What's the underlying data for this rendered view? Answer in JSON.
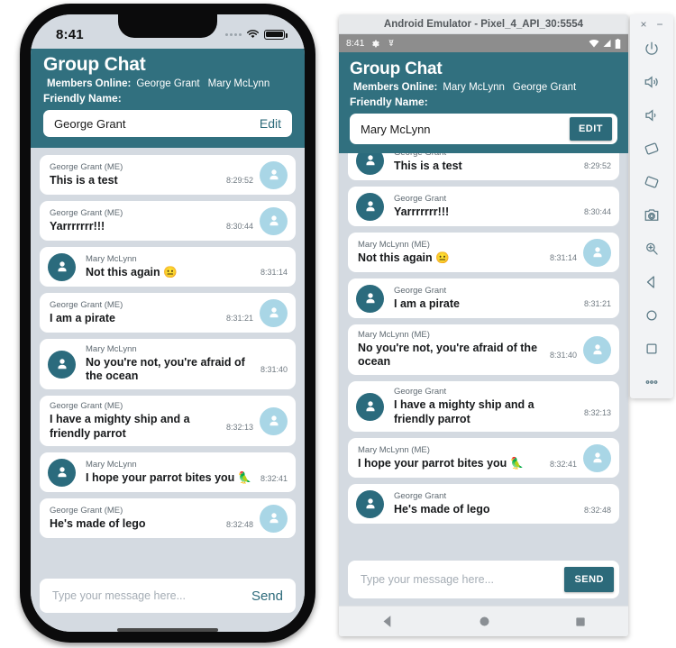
{
  "ios": {
    "status": {
      "time": "8:41",
      "signal_icon": "signal-dots-icon",
      "wifi_icon": "wifi-icon",
      "battery_icon": "battery-icon"
    },
    "header": {
      "title": "Group Chat",
      "members_label": "Members Online:",
      "members": [
        "George Grant",
        "Mary McLynn"
      ],
      "friendly_name_label": "Friendly Name:",
      "friendly_name_value": "George Grant",
      "edit_label": "Edit"
    },
    "messages": [
      {
        "sender": "George Grant (ME)",
        "text": "This is a test",
        "time": "8:29:52",
        "side": "mine"
      },
      {
        "sender": "George Grant (ME)",
        "text": "Yarrrrrrr!!!",
        "time": "8:30:44",
        "side": "mine"
      },
      {
        "sender": "Mary McLynn",
        "text": "Not this again 😐",
        "time": "8:31:14",
        "side": "theirs"
      },
      {
        "sender": "George Grant (ME)",
        "text": "I am a pirate",
        "time": "8:31:21",
        "side": "mine"
      },
      {
        "sender": "Mary McLynn",
        "text": "No you're not, you're afraid of the ocean",
        "time": "8:31:40",
        "side": "theirs"
      },
      {
        "sender": "George Grant (ME)",
        "text": "I have a mighty ship and a friendly parrot",
        "time": "8:32:13",
        "side": "mine"
      },
      {
        "sender": "Mary McLynn",
        "text": "I hope your parrot bites you 🦜",
        "time": "8:32:41",
        "side": "theirs"
      },
      {
        "sender": "George Grant (ME)",
        "text": "He's made of lego",
        "time": "8:32:48",
        "side": "mine"
      }
    ],
    "composer": {
      "placeholder": "Type your message here...",
      "send_label": "Send"
    }
  },
  "android": {
    "window_title": "Android Emulator - Pixel_4_API_30:5554",
    "status": {
      "time": "8:41",
      "gear_icon": "gear-icon",
      "debug_icon": "adb-icon",
      "wifi_icon": "wifi-icon",
      "signal_icon": "signal-icon",
      "battery_icon": "battery-icon"
    },
    "header": {
      "title": "Group Chat",
      "members_label": "Members Online:",
      "members": [
        "Mary McLynn",
        "George Grant"
      ],
      "friendly_name_label": "Friendly Name:",
      "friendly_name_value": "Mary McLynn",
      "edit_label": "EDIT"
    },
    "messages": [
      {
        "sender": "George Grant",
        "text": "This is a test",
        "time": "8:29:52",
        "side": "theirs"
      },
      {
        "sender": "George Grant",
        "text": "Yarrrrrrr!!!",
        "time": "8:30:44",
        "side": "theirs"
      },
      {
        "sender": "Mary McLynn (ME)",
        "text": "Not this again 😐",
        "time": "8:31:14",
        "side": "mine"
      },
      {
        "sender": "George Grant",
        "text": "I am a pirate",
        "time": "8:31:21",
        "side": "theirs"
      },
      {
        "sender": "Mary McLynn (ME)",
        "text": "No you're not, you're afraid of the ocean",
        "time": "8:31:40",
        "side": "mine"
      },
      {
        "sender": "George Grant",
        "text": "I have a mighty ship and a friendly parrot",
        "time": "8:32:13",
        "side": "theirs"
      },
      {
        "sender": "Mary McLynn (ME)",
        "text": "I hope your parrot bites you 🦜",
        "time": "8:32:41",
        "side": "mine"
      },
      {
        "sender": "George Grant",
        "text": "He's made of lego",
        "time": "8:32:48",
        "side": "theirs"
      }
    ],
    "composer": {
      "placeholder": "Type your message here...",
      "send_label": "SEND"
    },
    "nav": [
      "back-nav-icon",
      "home-nav-icon",
      "overview-nav-icon"
    ]
  },
  "emulator_toolbar": {
    "close_label": "×",
    "minimize_label": "−",
    "tools": [
      "power-icon",
      "volume-up-icon",
      "volume-down-icon",
      "rotate-left-icon",
      "rotate-right-icon",
      "screenshot-camera-icon",
      "zoom-icon",
      "back-icon",
      "home-icon",
      "overview-icon",
      "more-icon"
    ]
  },
  "colors": {
    "accent_teal": "#31707f",
    "avatar_me": "#a9d6e6",
    "avatar_them": "#2b6b7d",
    "chat_background": "#d4dae1"
  }
}
